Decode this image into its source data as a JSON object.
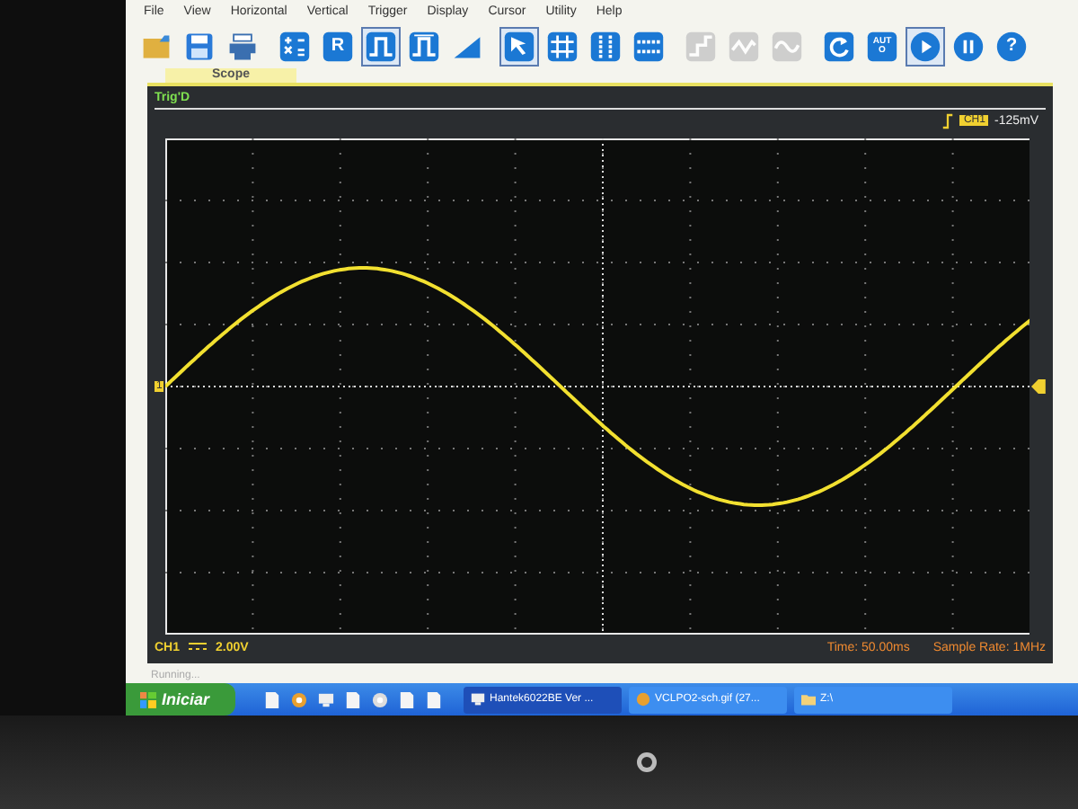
{
  "menu": [
    "File",
    "View",
    "Horizontal",
    "Vertical",
    "Trigger",
    "Display",
    "Cursor",
    "Utility",
    "Help"
  ],
  "toolbar": [
    {
      "kind": "open",
      "selected": false,
      "disabled": false
    },
    {
      "kind": "save",
      "selected": false,
      "disabled": false
    },
    {
      "kind": "print",
      "selected": false,
      "disabled": false
    },
    {
      "kind": "math",
      "selected": false,
      "disabled": false
    },
    {
      "kind": "ref",
      "label": "R",
      "selected": false,
      "disabled": false
    },
    {
      "kind": "pulse-rise",
      "selected": true,
      "disabled": false
    },
    {
      "kind": "pulse-fall",
      "selected": false,
      "disabled": false
    },
    {
      "kind": "ramp",
      "selected": false,
      "disabled": false
    },
    {
      "kind": "cursor",
      "selected": true,
      "disabled": false
    },
    {
      "kind": "grid",
      "selected": false,
      "disabled": false
    },
    {
      "kind": "vbars",
      "selected": false,
      "disabled": false
    },
    {
      "kind": "hbars",
      "selected": false,
      "disabled": false
    },
    {
      "kind": "step",
      "selected": false,
      "disabled": true
    },
    {
      "kind": "wave",
      "selected": false,
      "disabled": true
    },
    {
      "kind": "sine",
      "selected": false,
      "disabled": true
    },
    {
      "kind": "refresh",
      "selected": false,
      "disabled": false
    },
    {
      "kind": "auto",
      "label": "AUTO",
      "selected": false,
      "disabled": false
    },
    {
      "kind": "run",
      "selected": true,
      "disabled": false
    },
    {
      "kind": "pause",
      "selected": false,
      "disabled": false
    },
    {
      "kind": "help",
      "label": "?",
      "selected": false,
      "disabled": false
    }
  ],
  "tab": {
    "label": "Scope",
    "selected": true
  },
  "scope": {
    "status": "Trig'D",
    "trigger_channel": "CH1",
    "trigger_level": "-125mV",
    "channel_marker": "1",
    "channel": "CH1",
    "volts_per_div": "2.00V",
    "time": "Time: 50.00ms",
    "sample_rate": "Sample Rate: 1MHz"
  },
  "status_bar": "Running...",
  "taskbar": {
    "start": "Iniciar",
    "quick_launch": [
      {
        "kind": "app"
      },
      {
        "kind": "browser"
      },
      {
        "kind": "monitor"
      },
      {
        "kind": "document"
      },
      {
        "kind": "disc"
      },
      {
        "kind": "notepad"
      },
      {
        "kind": "file"
      }
    ],
    "tasks": [
      {
        "label": "Hantek6022BE Ver ...",
        "selected": true,
        "kind": "monitor"
      },
      {
        "label": "VCLPO2-sch.gif (27...",
        "selected": false,
        "kind": "browser"
      },
      {
        "label": "Z:\\",
        "selected": false,
        "kind": "folder"
      }
    ]
  }
}
